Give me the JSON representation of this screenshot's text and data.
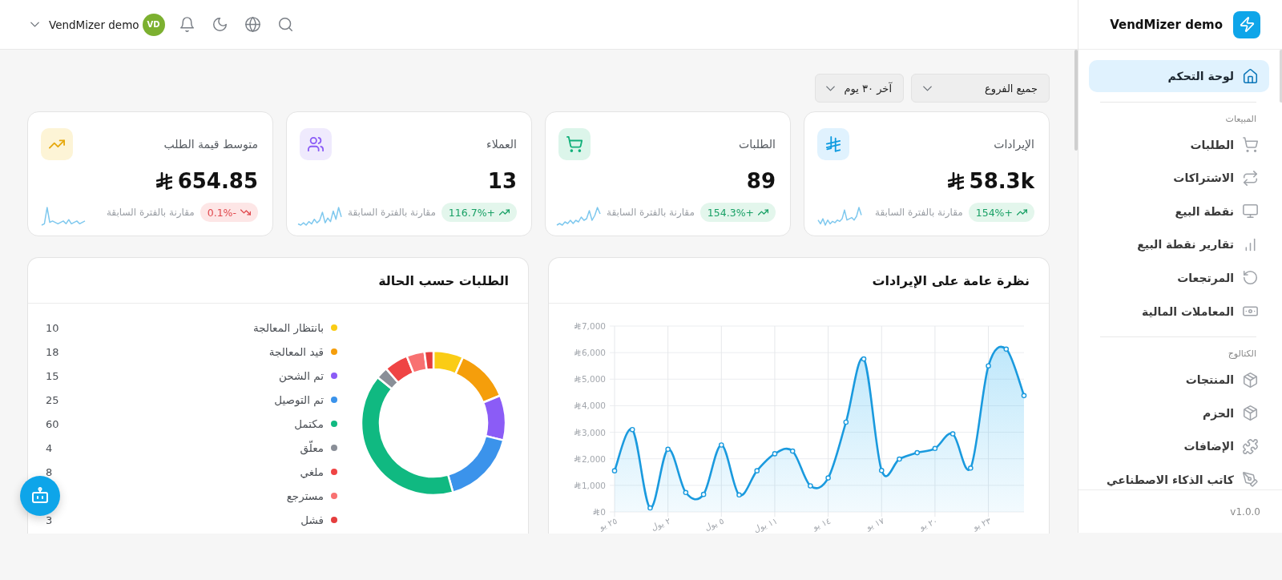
{
  "header": {
    "user_name": "VendMizer demo",
    "avatar_initials": "VD"
  },
  "sidebar": {
    "brand": "VendMizer demo",
    "sections": [
      {
        "items": [
          {
            "label": "لوحة التحكم",
            "selected": true
          }
        ]
      },
      {
        "title": "المبيعات",
        "items": [
          {
            "label": "الطلبات",
            "selected": false
          },
          {
            "label": "الاشتراكات",
            "selected": false
          },
          {
            "label": "نقطة البيع",
            "selected": false
          },
          {
            "label": "تقارير نقطة البيع",
            "selected": false
          },
          {
            "label": "المرتجعات",
            "selected": false
          },
          {
            "label": "المعاملات المالية",
            "selected": false
          }
        ]
      },
      {
        "title": "الكتالوج",
        "items": [
          {
            "label": "المنتجات",
            "selected": false
          },
          {
            "label": "الحزم",
            "selected": false
          },
          {
            "label": "الإضافات",
            "selected": false
          },
          {
            "label": "كاتب الذكاء الاصطناعي",
            "selected": false
          }
        ]
      }
    ],
    "version": "v1.0.0"
  },
  "filters": [
    {
      "value": "جميع الفروع"
    },
    {
      "value": "آخر ٣٠ يوم"
    }
  ],
  "stats": [
    {
      "kind": "revenue",
      "label": "الإيرادات",
      "value": "58.3k",
      "rising": true,
      "change": "+154%",
      "note": "مقارنة بالفترة السابقة"
    },
    {
      "kind": "orders",
      "label": "الطلبات",
      "value": "89",
      "rising": true,
      "change": "+154.3%",
      "note": "مقارنة بالفترة السابقة"
    },
    {
      "kind": "customers",
      "label": "العملاء",
      "value": "13",
      "rising": true,
      "change": "+116.7%",
      "note": "مقارنة بالفترة السابقة"
    },
    {
      "kind": "average",
      "label": "متوسط قيمة الطلب",
      "value": "654.85",
      "rising": false,
      "change": "-0.1%",
      "note": "مقارنة بالفترة السابقة"
    }
  ],
  "revenue_overview": {
    "title": "نظرة عامة على الإيرادات",
    "chart_data": {
      "type": "area",
      "grid": true,
      "categories": [
        "٢٥ يو",
        null,
        null,
        "٢ يول",
        null,
        null,
        "٥ يول",
        null,
        null,
        "١١ يول",
        null,
        null,
        "١٤ يو",
        null,
        null,
        "١٧ يو",
        null,
        null,
        "٢٠ يو",
        null,
        null,
        "٢٣ يو",
        null,
        null
      ],
      "values": [
        1550,
        3100,
        150,
        2360,
        730,
        660,
        2520,
        640,
        1550,
        2190,
        2290,
        980,
        1280,
        3380,
        5760,
        1560,
        1990,
        2230,
        2390,
        2940,
        1650,
        5500,
        6130,
        4380
      ],
      "ylim": [
        0,
        7000
      ],
      "yticks": [
        {
          "value": 0,
          "label": "0"
        },
        {
          "value": 1000,
          "label": "1,000"
        },
        {
          "value": 2000,
          "label": "2,000"
        },
        {
          "value": 3000,
          "label": "3,000"
        },
        {
          "value": 4000,
          "label": "4,000"
        },
        {
          "value": 5000,
          "label": "5,000"
        },
        {
          "value": 6000,
          "label": "6,000"
        },
        {
          "value": 7000,
          "label": "7,000"
        }
      ]
    }
  },
  "orders_by_status": {
    "title": "الطلبات حسب الحالة",
    "legend": [
      {
        "label": "بانتظار المعالجة",
        "color": "#facc15",
        "count": "10"
      },
      {
        "label": "قيد المعالجة",
        "color": "#f59e0b",
        "count": "18"
      },
      {
        "label": "تم الشحن",
        "color": "#8b5cf6",
        "count": "15"
      },
      {
        "label": "تم التوصيل",
        "color": "#3b93eb",
        "count": "25"
      },
      {
        "label": "مكتمل",
        "color": "#10b981",
        "count": "60"
      },
      {
        "label": "معلّق",
        "color": "#8a8f98",
        "count": "4"
      },
      {
        "label": "ملغي",
        "color": "#ef4444",
        "count": "8"
      },
      {
        "label": "مسترجع",
        "color": "#f87171"
      },
      {
        "label": "فشل",
        "color": "#e53e3e",
        "count": "3"
      }
    ],
    "chart_data": {
      "type": "donut",
      "values": [
        6.71,
        12.08,
        10.07,
        16.78,
        40.27,
        2.68,
        5.37,
        4.03,
        2.01
      ]
    }
  }
}
